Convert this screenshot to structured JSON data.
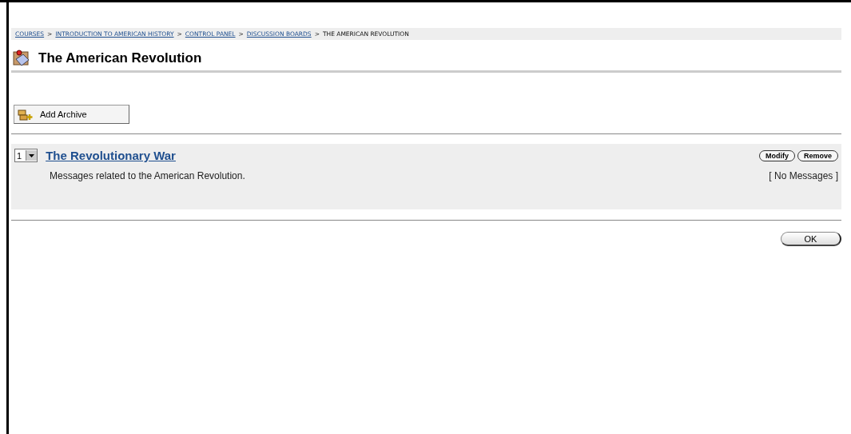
{
  "breadcrumbs": [
    {
      "label": "COURSES",
      "link": true
    },
    {
      "label": "INTRODUCTION TO AMERICAN HISTORY",
      "link": true
    },
    {
      "label": "CONTROL PANEL",
      "link": true
    },
    {
      "label": "DISCUSSION BOARDS",
      "link": true
    },
    {
      "label": "THE AMERICAN REVOLUTION",
      "link": false
    }
  ],
  "separator": ">",
  "title": "The American Revolution",
  "add_button": "Add Archive",
  "forums": [
    {
      "order": "1",
      "title": "The Revolutionary War",
      "description": "Messages related to the American Revolution.",
      "status": "[ No Messages ]",
      "actions": [
        "Modify",
        "Remove"
      ]
    }
  ],
  "ok_button": "OK"
}
